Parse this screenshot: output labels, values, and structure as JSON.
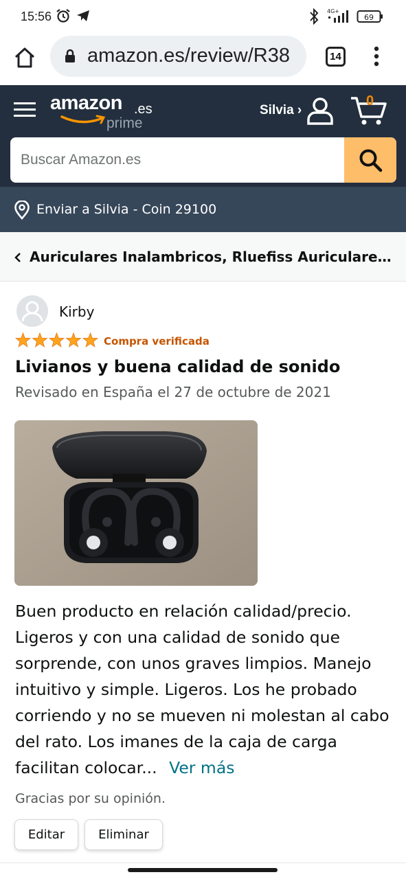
{
  "status_bar": {
    "time": "15:56",
    "network": "4G+",
    "battery": "69"
  },
  "browser": {
    "url": "amazon.es/review/R38",
    "tab_count": "14"
  },
  "header": {
    "logo_word": "amazon",
    "logo_tld": ".es",
    "logo_prime": "prime",
    "account_name": "Silvia ›",
    "cart_count": "0",
    "search_placeholder": "Buscar Amazon.es"
  },
  "delivery": {
    "text": "Enviar a Silvia - Coin 29100"
  },
  "breadcrumb": {
    "text": "Auriculares Inalambricos, Rluefiss Auriculares I..."
  },
  "review": {
    "reviewer": "Kirby",
    "rating": 5,
    "verified": "Compra verificada",
    "title": "Livianos y buena calidad de sonido",
    "date": "Revisado en España el 27 de octubre de 2021",
    "body": "Buen producto en relación calidad/precio. Ligeros y con una calidad de sonido que sorprende, con unos graves limpios. Manejo intuitivo y simple. Ligeros. Los he probado corriendo y no se mueven ni molestan al cabo del rato. Los imanes de la caja de carga facilitan colocar...",
    "more_label": "Ver más",
    "thanks": "Gracias por su opinión.",
    "edit_label": "Editar",
    "delete_label": "Eliminar"
  },
  "colors": {
    "header_bg": "#232f3e",
    "delivery_bg": "#37475a",
    "search_button": "#febd69",
    "star": "#ffa41c",
    "verified": "#c45500",
    "link": "#007185"
  }
}
